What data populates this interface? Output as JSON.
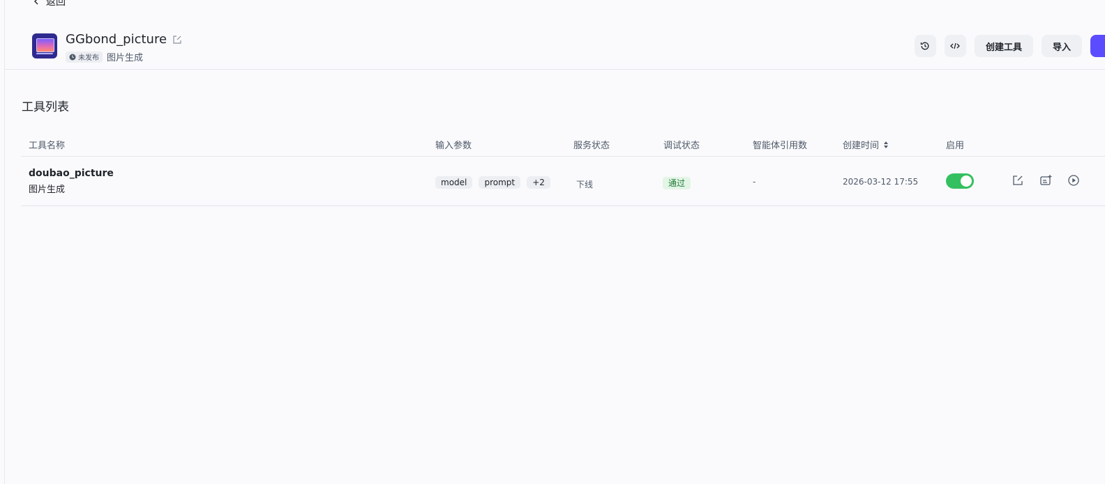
{
  "nav": {
    "back_label": "返回"
  },
  "app": {
    "name": "GGbond_picture",
    "status_badge": "未发布",
    "category": "图片生成"
  },
  "toolbar": {
    "history_icon": "history-icon",
    "code_icon": "code-icon",
    "create_tool_label": "创建工具",
    "import_label": "导入"
  },
  "section": {
    "title": "工具列表"
  },
  "table": {
    "columns": {
      "name": "工具名称",
      "inputs": "输入参数",
      "service_status": "服务状态",
      "debug_status": "调试状态",
      "agent_refs": "智能体引用数",
      "created_at": "创建时间",
      "enabled": "启用"
    },
    "rows": [
      {
        "name": "doubao_picture",
        "description": "图片生成",
        "inputs": [
          "model",
          "prompt"
        ],
        "inputs_more": "+2",
        "service_status": "下线",
        "debug_status": "通过",
        "agent_refs": "-",
        "created_at": "2026-03-12 17:55",
        "enabled": true
      }
    ]
  },
  "colors": {
    "accent": "#5b4cff",
    "toggle_on": "#34c060",
    "pass_bg": "#e3f5e6",
    "pass_text": "#1f7a34"
  }
}
